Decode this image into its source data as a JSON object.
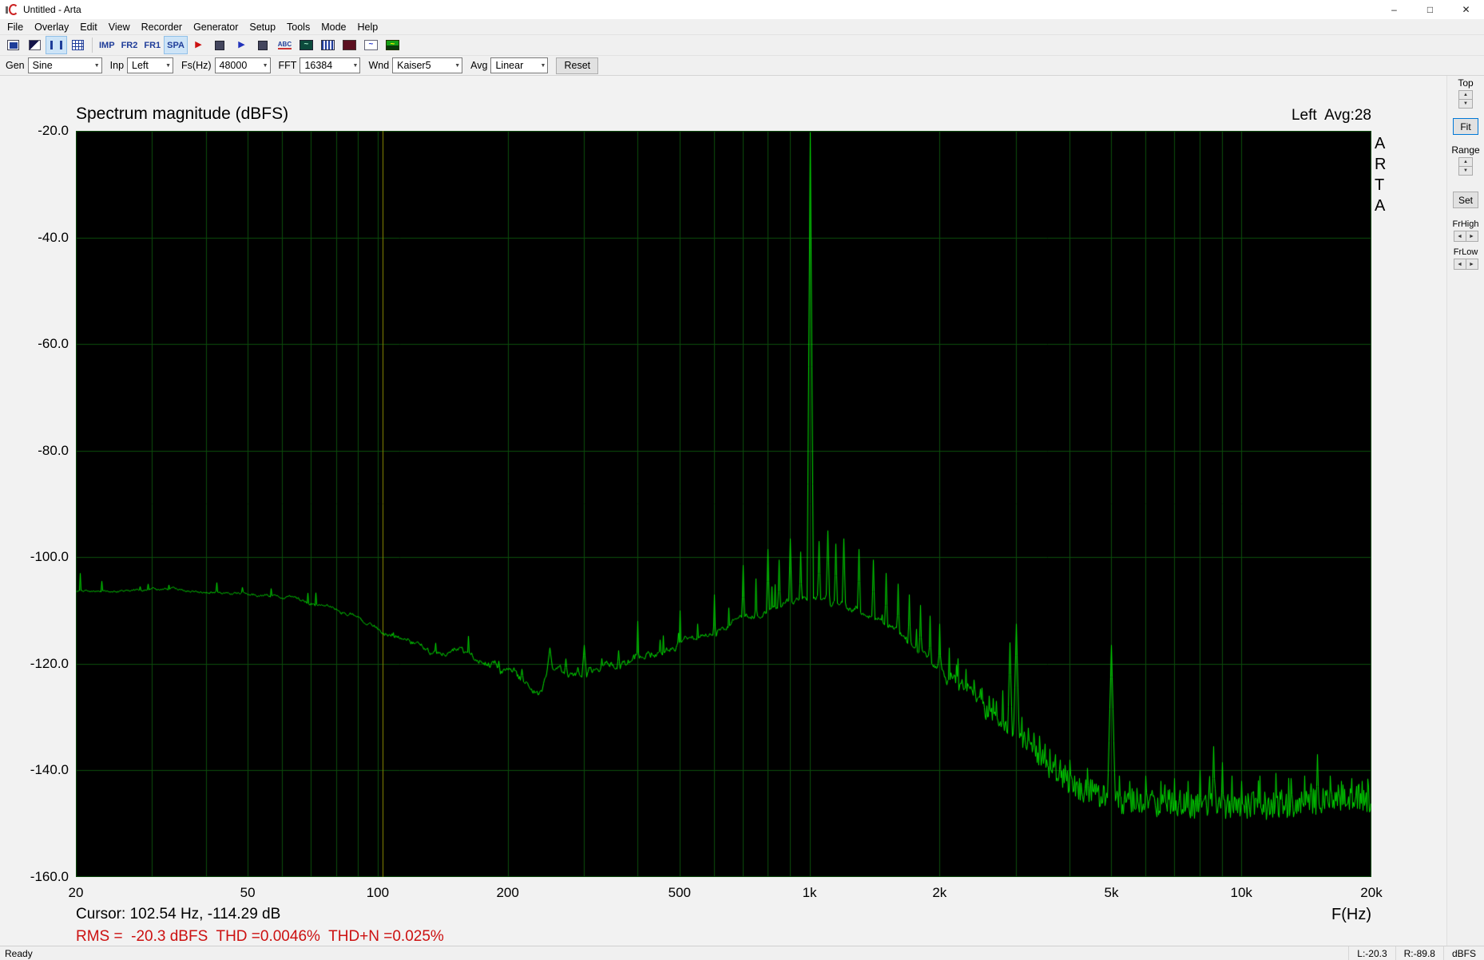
{
  "window": {
    "title": "Untitled - Arta",
    "minimize_glyph": "–",
    "maximize_glyph": "□",
    "close_glyph": "✕",
    "status_left": "Ready",
    "status_right": [
      "L:-20.3",
      "R:-89.8",
      "dBFS"
    ]
  },
  "menu": {
    "items": [
      "File",
      "Overlay",
      "Edit",
      "View",
      "Recorder",
      "Generator",
      "Setup",
      "Tools",
      "Mode",
      "Help"
    ]
  },
  "toolbar": {
    "buttons": [
      {
        "name": "duplicate-window-icon",
        "type": "copy"
      },
      {
        "name": "invert-colors-icon",
        "type": "invert"
      },
      {
        "name": "pause-button",
        "type": "pause",
        "pressed": true
      },
      {
        "name": "grid-values-button",
        "type": "grid"
      },
      {
        "name": "toolbar-separator",
        "type": "sep"
      },
      {
        "name": "imp-mode-button",
        "type": "text",
        "label": "IMP"
      },
      {
        "name": "fr2-mode-button",
        "type": "text",
        "label": "FR2"
      },
      {
        "name": "fr1-mode-button",
        "type": "text",
        "label": "FR1"
      },
      {
        "name": "spa-mode-button",
        "type": "text",
        "label": "SPA",
        "pressed": true
      },
      {
        "name": "record-button",
        "type": "glyph",
        "glyph": "▶",
        "color": "#cc1111"
      },
      {
        "name": "record-stop-button",
        "type": "stop"
      },
      {
        "name": "play-button",
        "type": "glyph",
        "glyph": "▶",
        "color": "#2233bb"
      },
      {
        "name": "play-stop-button",
        "type": "stop"
      },
      {
        "name": "abc-overlay-button",
        "type": "abc",
        "label": "ABC"
      },
      {
        "name": "scope-view-button",
        "type": "scope"
      },
      {
        "name": "level-meter-button",
        "type": "meter"
      },
      {
        "name": "dark-display-button",
        "type": "darkred"
      },
      {
        "name": "signal-wave-button",
        "type": "sine"
      },
      {
        "name": "green-scope-button",
        "type": "greenwave"
      }
    ]
  },
  "controls": {
    "gen": {
      "label": "Gen",
      "value": "Sine"
    },
    "inp": {
      "label": "Inp",
      "value": "Left"
    },
    "fs": {
      "label": "Fs(Hz)",
      "value": "48000"
    },
    "fft": {
      "label": "FFT",
      "value": "16384"
    },
    "wnd": {
      "label": "Wnd",
      "value": "Kaiser5"
    },
    "avg": {
      "label": "Avg",
      "value": "Linear"
    },
    "reset_label": "Reset"
  },
  "sidebar": {
    "top_label": "Top",
    "fit_label": "Fit",
    "range_label": "Range",
    "set_label": "Set",
    "frhigh_label": "FrHigh",
    "frlow_label": "FrLow",
    "up_glyph": "▲",
    "down_glyph": "▼",
    "left_glyph": "◄",
    "right_glyph": "►"
  },
  "plot": {
    "title": "Spectrum magnitude (dBFS)",
    "legend": "Left  Avg:28",
    "arta_letters": [
      "A",
      "R",
      "T",
      "A"
    ],
    "xlabel": "F(Hz)",
    "cursor_text": "Cursor: 102.54 Hz, -114.29 dB",
    "rms_text": "RMS =  -20.3 dBFS  THD =0.0046%  THD+N =0.025%"
  },
  "chart_data": {
    "type": "line",
    "title": "Spectrum magnitude (dBFS)",
    "legend": "Left  Avg:28",
    "xlabel": "F(Hz)",
    "x_scale": "log",
    "x_range": [
      20,
      20000
    ],
    "ylim": [
      -160,
      -20
    ],
    "x_ticks": [
      [
        20,
        "20"
      ],
      [
        50,
        "50"
      ],
      [
        100,
        "100"
      ],
      [
        200,
        "200"
      ],
      [
        500,
        "500"
      ],
      [
        1000,
        "1k"
      ],
      [
        2000,
        "2k"
      ],
      [
        5000,
        "5k"
      ],
      [
        10000,
        "10k"
      ],
      [
        20000,
        "20k"
      ]
    ],
    "y_ticks": [
      [
        -20,
        "-20.0"
      ],
      [
        -40,
        "-40.0"
      ],
      [
        -60,
        "-60.0"
      ],
      [
        -80,
        "-80.0"
      ],
      [
        -100,
        "-100.0"
      ],
      [
        -120,
        "-120.0"
      ],
      [
        -140,
        "-140.0"
      ],
      [
        -160,
        "-160.0"
      ]
    ],
    "grid": true,
    "bg_color": "#000000",
    "grid_color": "#0b4d0b",
    "trace_color": "#00e400",
    "cursor_color": "#8a8a00",
    "cursor": {
      "freq_hz": 102.54,
      "level_db": -114.29
    },
    "rms_dbfs": -20.3,
    "thd_pct": 0.0046,
    "thdn_pct": 0.025,
    "fundamental": {
      "freq_hz": 1000,
      "level_dbfs": -20.3
    },
    "noise_floor": [
      [
        20,
        -106.5
      ],
      [
        30,
        -106
      ],
      [
        45,
        -106.5
      ],
      [
        60,
        -107.5
      ],
      [
        75,
        -109
      ],
      [
        90,
        -111
      ],
      [
        100,
        -113
      ],
      [
        115,
        -115.5
      ],
      [
        135,
        -117.5
      ],
      [
        160,
        -119
      ],
      [
        185,
        -120.5
      ],
      [
        210,
        -122
      ],
      [
        235,
        -125
      ],
      [
        255,
        -121.5
      ],
      [
        275,
        -122.5
      ],
      [
        305,
        -121.5
      ],
      [
        350,
        -120
      ],
      [
        400,
        -119
      ],
      [
        460,
        -117.5
      ],
      [
        520,
        -116
      ],
      [
        600,
        -114
      ],
      [
        700,
        -112
      ],
      [
        800,
        -110
      ],
      [
        900,
        -108.5
      ],
      [
        1000,
        -107.5
      ],
      [
        1100,
        -107.8
      ],
      [
        1250,
        -109.5
      ],
      [
        1400,
        -111.5
      ],
      [
        1600,
        -114.5
      ],
      [
        1800,
        -117.5
      ],
      [
        2000,
        -120
      ],
      [
        2200,
        -123
      ],
      [
        2400,
        -126
      ],
      [
        2700,
        -129.5
      ],
      [
        3000,
        -133
      ],
      [
        3300,
        -136
      ],
      [
        3600,
        -139
      ],
      [
        4000,
        -142
      ],
      [
        4400,
        -144
      ],
      [
        5000,
        -145.5
      ],
      [
        6000,
        -146.2
      ],
      [
        8000,
        -146.5
      ],
      [
        11000,
        -146.5
      ],
      [
        15000,
        -146
      ],
      [
        20000,
        -145.3
      ]
    ],
    "smooth_jitter": [
      [
        20,
        0.35
      ],
      [
        90,
        0.6
      ],
      [
        130,
        1.2
      ],
      [
        200,
        1.6
      ],
      [
        300,
        1.5
      ],
      [
        500,
        1.2
      ],
      [
        900,
        1.0
      ],
      [
        1500,
        1.2
      ],
      [
        2500,
        1.6
      ],
      [
        3500,
        1.2
      ],
      [
        5000,
        0.8
      ],
      [
        20000,
        0.7
      ]
    ],
    "fuzz": [
      [
        20,
        0
      ],
      [
        1800,
        0.3
      ],
      [
        2600,
        1.2
      ],
      [
        3500,
        1.9
      ],
      [
        4300,
        2.4
      ],
      [
        5000,
        2.6
      ],
      [
        20000,
        2.6
      ]
    ],
    "peaks": [
      [
        155,
        -117.5,
        1.2
      ],
      [
        190,
        -119.5,
        1.2
      ],
      [
        215,
        -121,
        1.2
      ],
      [
        250,
        -117,
        1.2
      ],
      [
        272,
        -119.5,
        1.2
      ],
      [
        300,
        -116.5,
        2
      ],
      [
        330,
        -119,
        1.5
      ],
      [
        360,
        -117.5,
        2
      ],
      [
        400,
        -112
      ],
      [
        450,
        -115.5
      ],
      [
        500,
        -110
      ],
      [
        550,
        -112.5
      ],
      [
        600,
        -107
      ],
      [
        650,
        -109.5
      ],
      [
        700,
        -101.5
      ],
      [
        750,
        -104
      ],
      [
        800,
        -98.5
      ],
      [
        850,
        -100.5
      ],
      [
        900,
        -96.5
      ],
      [
        950,
        -99
      ],
      [
        1000,
        -20.3,
        22
      ],
      [
        1050,
        -97
      ],
      [
        1100,
        -95
      ],
      [
        1150,
        -97.5
      ],
      [
        1200,
        -96.5
      ],
      [
        1300,
        -98.5
      ],
      [
        1400,
        -100.5
      ],
      [
        1500,
        -103
      ],
      [
        1600,
        -105
      ],
      [
        1700,
        -107
      ],
      [
        1800,
        -109
      ],
      [
        1900,
        -111
      ],
      [
        2000,
        -112.5
      ],
      [
        2100,
        -117
      ],
      [
        2200,
        -119
      ],
      [
        2300,
        -121
      ],
      [
        2400,
        -123
      ],
      [
        2500,
        -124.5
      ],
      [
        2600,
        -126
      ],
      [
        2700,
        -127
      ],
      [
        2800,
        -125
      ],
      [
        2900,
        -116
      ],
      [
        3000,
        -112.5
      ],
      [
        3100,
        -130
      ],
      [
        3200,
        -132
      ],
      [
        3300,
        -133
      ],
      [
        3400,
        -133.5
      ],
      [
        3500,
        -135
      ],
      [
        3600,
        -136
      ],
      [
        3700,
        -137
      ],
      [
        3800,
        -138
      ],
      [
        3900,
        -139
      ],
      [
        4000,
        -138
      ],
      [
        4100,
        -141
      ],
      [
        4200,
        -141.5
      ],
      [
        4400,
        -142
      ],
      [
        4600,
        -142.5
      ],
      [
        4800,
        -143
      ],
      [
        5000,
        -116.5
      ],
      [
        5200,
        -141
      ],
      [
        5500,
        -142
      ],
      [
        6000,
        -141
      ],
      [
        6500,
        -142
      ],
      [
        7000,
        -141.5
      ],
      [
        7500,
        -142
      ],
      [
        8000,
        -140
      ],
      [
        8600,
        -135.5
      ],
      [
        9000,
        -138.5
      ],
      [
        9500,
        -141
      ],
      [
        10000,
        -142
      ],
      [
        11000,
        -141
      ],
      [
        12000,
        -140.5
      ],
      [
        13000,
        -141.5
      ],
      [
        14000,
        -141
      ],
      [
        15000,
        -137
      ],
      [
        16000,
        -141
      ],
      [
        17000,
        -142
      ],
      [
        18000,
        -141.5
      ],
      [
        19000,
        -142
      ]
    ]
  }
}
